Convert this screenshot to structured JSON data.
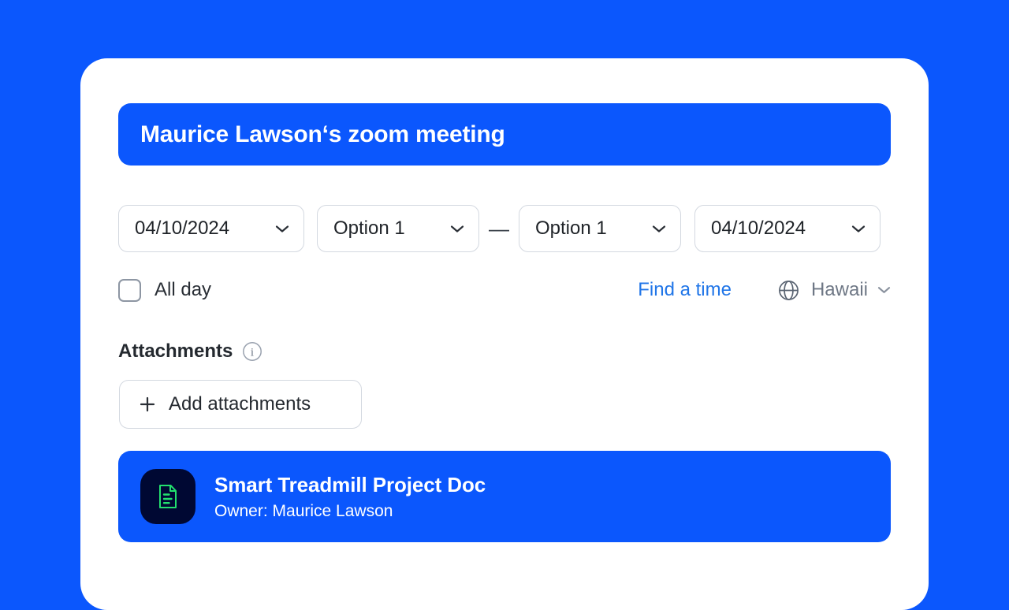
{
  "theme": {
    "background_blue": "#0B57FD",
    "accent_blue": "#0B57FD",
    "link_blue": "#2176E8",
    "doc_icon_green": "#22E06E",
    "doc_icon_background": "#000833",
    "border_gray": "#D3D8E0",
    "muted_text": "#6E7785"
  },
  "meeting": {
    "title": "Maurice Lawson‘s zoom meeting"
  },
  "schedule": {
    "start_date": "04/10/2024",
    "start_time": "Option 1",
    "range_separator": "—",
    "end_time": "Option 1",
    "end_date": "04/10/2024",
    "all_day_label": "All day",
    "all_day_checked": false,
    "find_a_time_label": "Find a time",
    "timezone": "Hawaii",
    "globe_icon": "globe-icon",
    "chevron_icon": "chevron-down-icon"
  },
  "attachments": {
    "section_title": "Attachments",
    "info_icon": "info-icon",
    "info_glyph": "i",
    "add_button_label": "Add attachments",
    "add_button_icon": "plus-icon",
    "items": [
      {
        "name": "Smart Treadmill Project Doc",
        "owner": "Owner: Maurice Lawson",
        "icon": "document-icon"
      }
    ]
  }
}
